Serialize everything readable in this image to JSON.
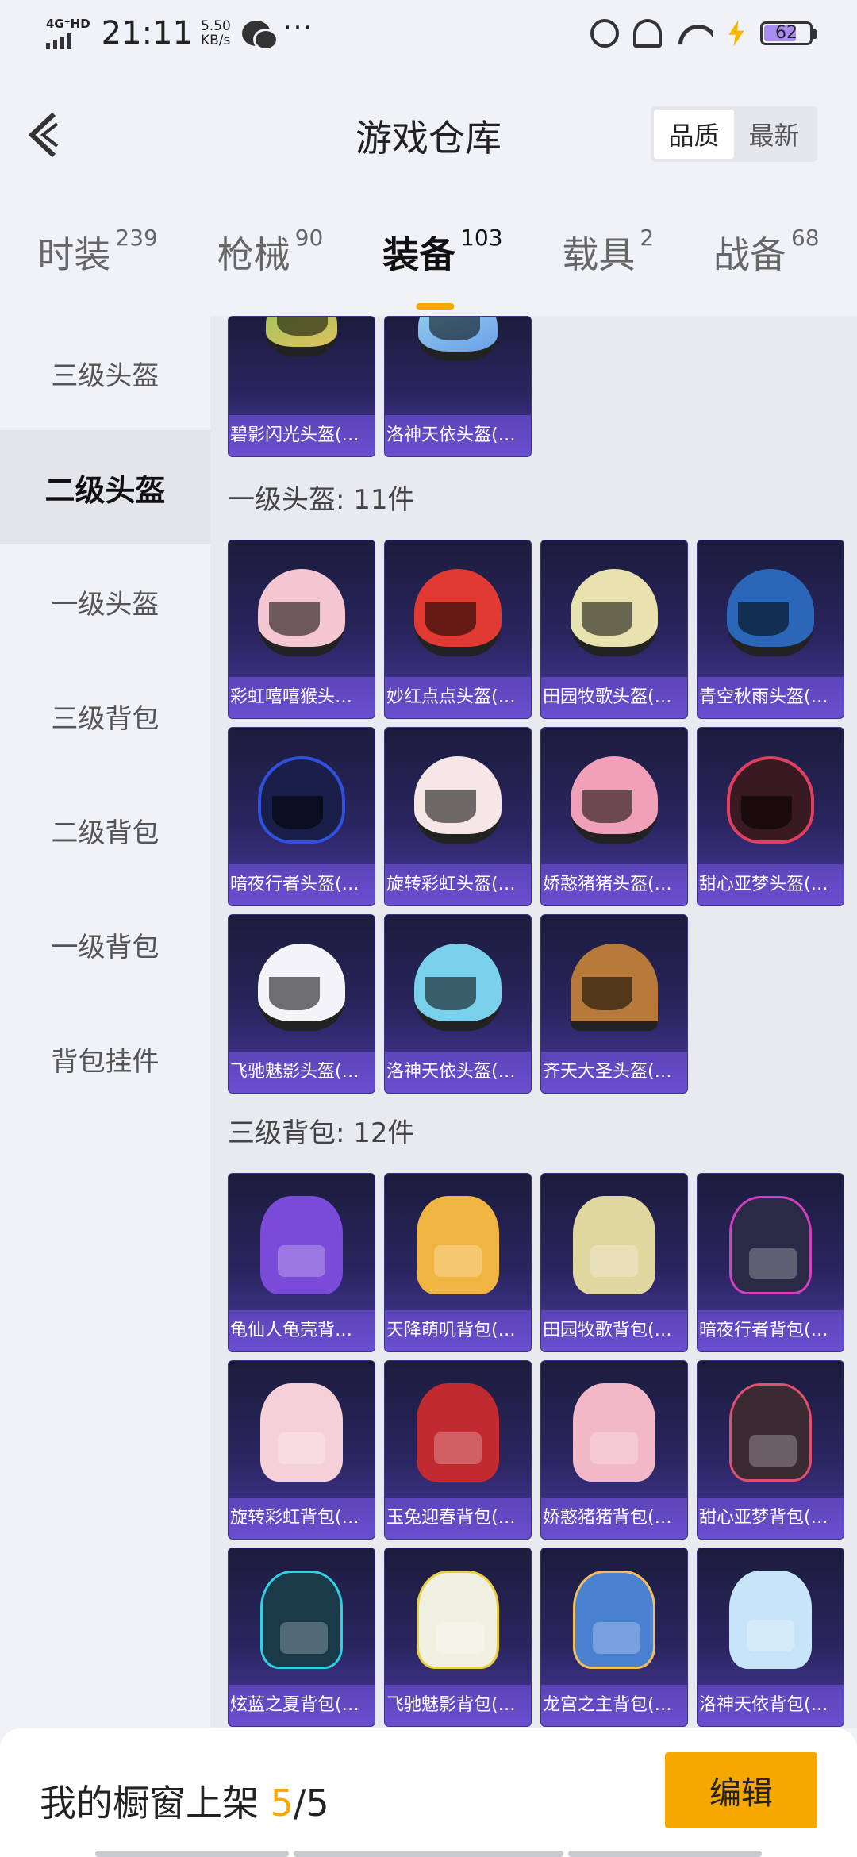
{
  "status_bar": {
    "network": "4G⁺HD",
    "time": "21:11",
    "speed_value": "5.50",
    "speed_unit": "KB/s",
    "more": "···",
    "battery": "62"
  },
  "header": {
    "title": "游戏仓库",
    "sort_options": [
      "品质",
      "最新"
    ],
    "sort_selected": "品质"
  },
  "tabs": [
    {
      "label": "时装",
      "count": "239"
    },
    {
      "label": "枪械",
      "count": "90"
    },
    {
      "label": "装备",
      "count": "103"
    },
    {
      "label": "载具",
      "count": "2"
    },
    {
      "label": "战备",
      "count": "68"
    }
  ],
  "sidebar": [
    "三级头盔",
    "二级头盔",
    "一级头盔",
    "三级背包",
    "二级背包",
    "一级背包",
    "背包挂件"
  ],
  "sidebar_active": "二级头盔",
  "top_items": [
    "碧影闪光头盔(…",
    "洛神天依头盔(…"
  ],
  "section1": {
    "title": "一级头盔: 11件",
    "items": [
      "彩虹嘻嘻猴头…",
      "妙红点点头盔(…",
      "田园牧歌头盔(…",
      "青空秋雨头盔(…",
      "暗夜行者头盔(…",
      "旋转彩虹头盔(…",
      "娇憨猪猪头盔(…",
      "甜心亚梦头盔(…",
      "飞驰魅影头盔(…",
      "洛神天依头盔(…",
      "齐天大圣头盔(…"
    ]
  },
  "section2": {
    "title": "三级背包: 12件",
    "items": [
      "龟仙人龟壳背…",
      "天降萌叽背包(…",
      "田园牧歌背包(…",
      "暗夜行者背包(…",
      "旋转彩虹背包(…",
      "玉兔迎春背包(…",
      "娇憨猪猪背包(…",
      "甜心亚梦背包(…",
      "炫蓝之夏背包(…",
      "飞驰魅影背包(…",
      "龙宫之主背包(…",
      "洛神天依背包(…"
    ]
  },
  "bottom": {
    "label": "我的橱窗上架",
    "count": "5",
    "total": "/5",
    "edit_label": "编辑"
  },
  "colors": {
    "accent": "#f5a800",
    "card_caption": "#6a4fd0"
  }
}
